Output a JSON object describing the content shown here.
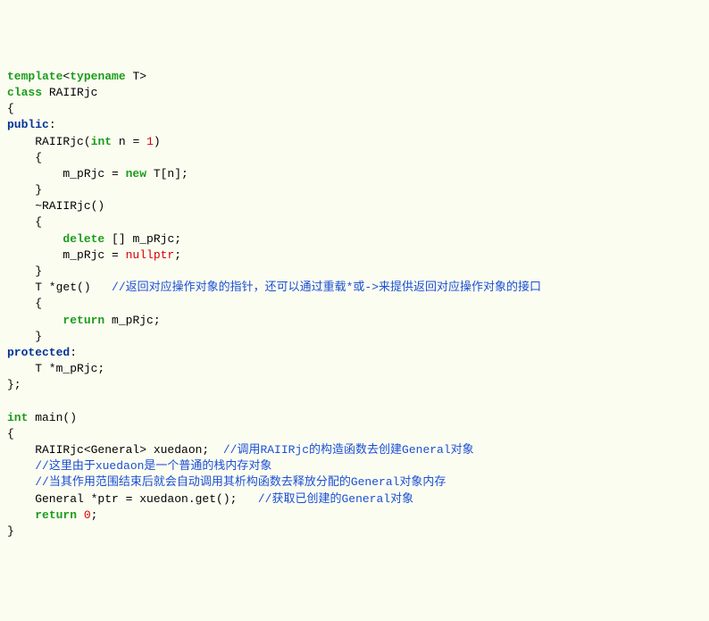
{
  "code": {
    "line1": {
      "t1": "template",
      "t2": "typename",
      "T": "T"
    },
    "line2": {
      "class": "class",
      "name": "RAIIRjc"
    },
    "line3": "{",
    "line4": {
      "public": "public",
      "colon": ":"
    },
    "line5": {
      "name": "RAIIRjc(",
      "int": "int",
      "rest1": " n = ",
      "one": "1",
      "rest2": ")"
    },
    "line6": "    {",
    "line7": {
      "pre": "        m_pRjc = ",
      "new": "new",
      "rest": " T[n];"
    },
    "line8": "    }",
    "line9": "    ~RAIIRjc()",
    "line10": "    {",
    "line11": {
      "pre": "        ",
      "delete": "delete",
      "rest": " [] m_pRjc;"
    },
    "line12": {
      "pre": "        m_pRjc = ",
      "null": "nullptr",
      "semi": ";"
    },
    "line13": "    }",
    "line14": {
      "text": "    T *get()   ",
      "cmt": "//返回对应操作对象的指针，还可以通过重载*或->来提供返回对应操作对象的接口"
    },
    "line15": "    {",
    "line16": {
      "pre": "        ",
      "ret": "return",
      "rest": " m_pRjc;"
    },
    "line17": "    }",
    "line18": {
      "protected": "protected",
      "colon": ":"
    },
    "line19": "    T *m_pRjc;",
    "line20": "};",
    "blank1": "",
    "line21": {
      "int": "int",
      "rest": " main()"
    },
    "line22": "{",
    "line23": {
      "text": "    RAIIRjc<General> xuedaon;  ",
      "cmt": "//调用RAIIRjc的构造函数去创建General对象"
    },
    "line24": {
      "pre": "    ",
      "cmt": "//这里由于xuedaon是一个普通的栈内存对象"
    },
    "line25": {
      "pre": "    ",
      "cmt": "//当其作用范围结束后就会自动调用其析构函数去释放分配的General对象内存"
    },
    "line26": {
      "text": "    General *ptr = xuedaon.get();   ",
      "cmt": "//获取已创建的General对象"
    },
    "line27": {
      "pre": "    ",
      "ret": "return",
      "sp": " ",
      "zero": "0",
      "semi": ";"
    },
    "line28": "}"
  }
}
